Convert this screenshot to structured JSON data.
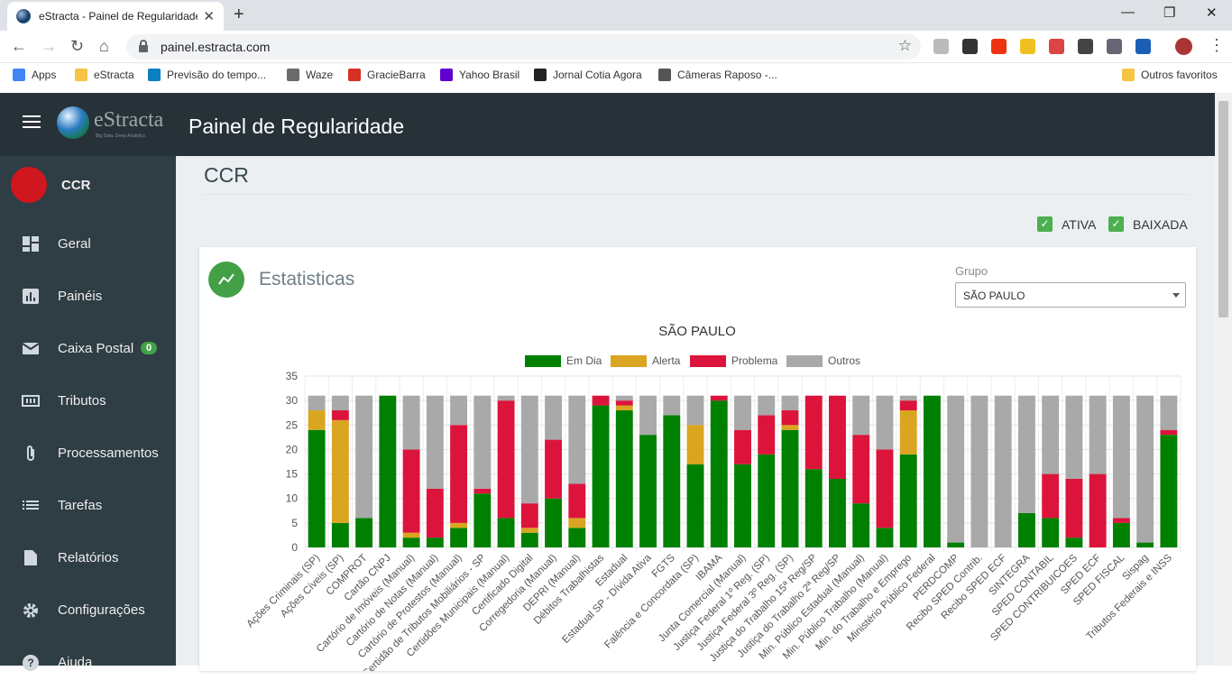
{
  "browser": {
    "tab_title": "eStracta - Painel de Regularidade",
    "url": "painel.estracta.com",
    "bookmarks": [
      {
        "label": "Apps",
        "color": "#4285f4"
      },
      {
        "label": "eStracta",
        "color": "#f6c445"
      },
      {
        "label": "Previsão do tempo...",
        "color": "#0a7fc1"
      },
      {
        "label": "Waze",
        "color": "#6b6b6b"
      },
      {
        "label": "GracieBarra",
        "color": "#d93025"
      },
      {
        "label": "Yahoo Brasil",
        "color": "#6001d2"
      },
      {
        "label": "Jornal Cotia Agora",
        "color": "#222222"
      },
      {
        "label": "Câmeras Raposo -...",
        "color": "#555555"
      }
    ],
    "other_bookmarks": "Outros favoritos"
  },
  "app": {
    "title": "Painel de Regularidade",
    "logo_text": "eStracta",
    "logo_tagline": "Big Data. Deep Analytics."
  },
  "sidebar": {
    "org": "CCR",
    "items": [
      {
        "label": "Geral",
        "icon": "dashboard-icon"
      },
      {
        "label": "Painéis",
        "icon": "bar-chart-icon"
      },
      {
        "label": "Caixa Postal",
        "icon": "mail-icon",
        "badge": "0"
      },
      {
        "label": "Tributos",
        "icon": "tributos-icon"
      },
      {
        "label": "Processamentos",
        "icon": "paperclip-icon"
      },
      {
        "label": "Tarefas",
        "icon": "list-icon"
      },
      {
        "label": "Relatórios",
        "icon": "document-icon"
      },
      {
        "label": "Configurações",
        "icon": "gear-icon"
      },
      {
        "label": "Ajuda",
        "icon": "help-icon"
      }
    ]
  },
  "page": {
    "title": "CCR",
    "filters": [
      {
        "label": "ATIVA",
        "checked": true
      },
      {
        "label": "BAIXADA",
        "checked": true
      }
    ],
    "card_title": "Estatisticas",
    "group_label": "Grupo",
    "group_value": "SÃO PAULO"
  },
  "chart_data": {
    "type": "bar",
    "stacked": true,
    "title": "SÃO PAULO",
    "ylim": [
      0,
      35
    ],
    "yticks": [
      0,
      5,
      10,
      15,
      20,
      25,
      30,
      35
    ],
    "grid": true,
    "legend_position": "top",
    "categories": [
      "Ações Criminais (SP)",
      "Ações Cíveis (SP)",
      "COMPROT",
      "Cartão CNPJ",
      "Cartório de Imóveis (Manual)",
      "Cartório de Notas (Manual)",
      "Cartório de Protestos (Manual)",
      "Certidão de Tributos Mobiliários - SP",
      "Certidões Municipais (Manual)",
      "Certificado Digital",
      "Corregedoria (Manual)",
      "DEPRI (Manual)",
      "Débitos Trabalhistas",
      "Estadual",
      "Estadual SP - Dívida Ativa",
      "FGTS",
      "Falência e Concordata (SP)",
      "IBAMA",
      "Junta Comercial (Manual)",
      "Justiça Federal 1º Reg. (SP)",
      "Justiça Federal 3º Reg. (SP)",
      "Justiça do Trabalho 15ª Reg/SP",
      "Justiça do Trabalho 2ª Reg/SP",
      "Min. Público Estadual (Manual)",
      "Min. Público Trabalho (Manual)",
      "Min. do Trabalho e Emprego",
      "Ministério Público Federal",
      "PERDCOMP",
      "Recibo SPED Contrib.",
      "Recibo SPED ECF",
      "SINTEGRA",
      "SPED CONTABIL",
      "SPED CONTRIBUICOES",
      "SPED ECF",
      "SPED FISCAL",
      "Sispag",
      "Tributos Federais e INSS"
    ],
    "series": [
      {
        "name": "Em Dia",
        "color": "#008000",
        "values": [
          24,
          5,
          6,
          31,
          2,
          2,
          4,
          11,
          6,
          3,
          10,
          4,
          29,
          28,
          23,
          27,
          17,
          30,
          17,
          19,
          24,
          16,
          14,
          9,
          4,
          19,
          31,
          1,
          0,
          0,
          7,
          6,
          2,
          0,
          5,
          1,
          23
        ]
      },
      {
        "name": "Alerta",
        "color": "#daa520",
        "values": [
          4,
          21,
          0,
          0,
          1,
          0,
          1,
          0,
          0,
          1,
          0,
          2,
          0,
          1,
          0,
          0,
          8,
          0,
          0,
          0,
          1,
          0,
          0,
          0,
          0,
          9,
          0,
          0,
          0,
          0,
          0,
          0,
          0,
          0,
          0,
          0,
          0
        ]
      },
      {
        "name": "Problema",
        "color": "#dc143c",
        "values": [
          0,
          2,
          0,
          0,
          17,
          10,
          20,
          1,
          24,
          5,
          12,
          7,
          2,
          1,
          0,
          0,
          0,
          1,
          7,
          8,
          3,
          15,
          17,
          14,
          16,
          2,
          0,
          0,
          0,
          0,
          0,
          9,
          12,
          15,
          1,
          0,
          1
        ]
      },
      {
        "name": "Outros",
        "color": "#a9a9a9",
        "values": [
          3,
          3,
          25,
          0,
          11,
          19,
          6,
          19,
          1,
          22,
          9,
          18,
          0,
          1,
          8,
          4,
          6,
          0,
          7,
          4,
          3,
          0,
          0,
          8,
          11,
          1,
          0,
          30,
          31,
          31,
          24,
          16,
          17,
          16,
          25,
          30,
          7
        ]
      }
    ]
  }
}
